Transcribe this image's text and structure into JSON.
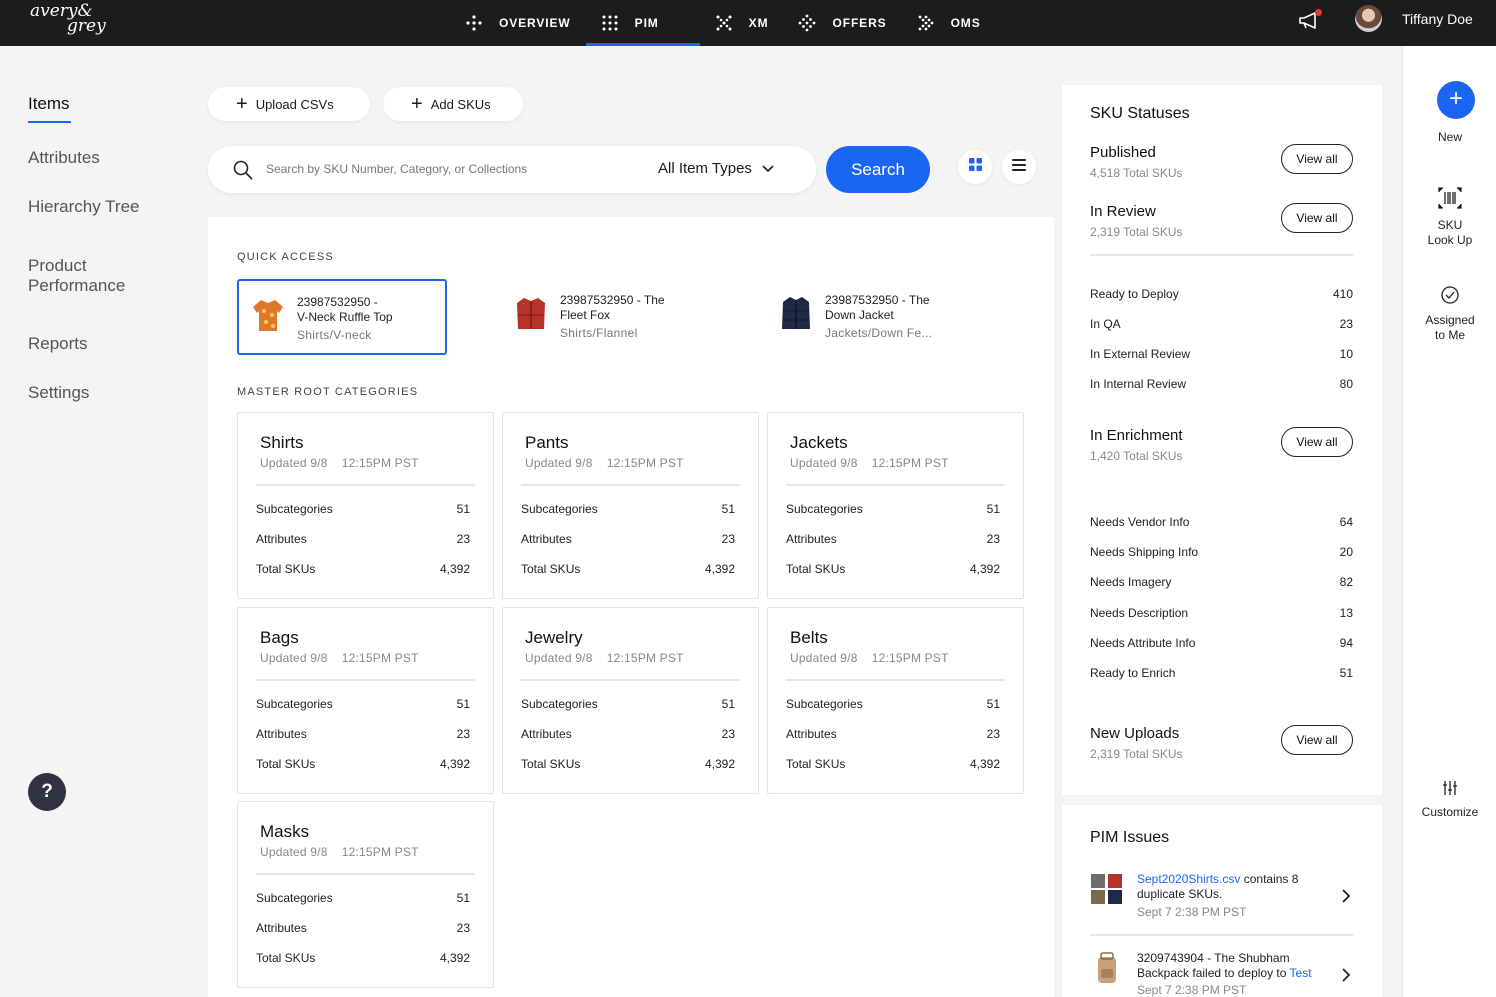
{
  "brand": {
    "line1": "avery&",
    "line2": "grey"
  },
  "topnav": [
    {
      "label": "OVERVIEW",
      "icon": "overview-icon",
      "active": false
    },
    {
      "label": "PIM",
      "icon": "pim-grid-icon",
      "active": true
    },
    {
      "label": "XM",
      "icon": "xm-icon",
      "active": false
    },
    {
      "label": "OFFERS",
      "icon": "offers-icon",
      "active": false
    },
    {
      "label": "OMS",
      "icon": "oms-icon",
      "active": false
    }
  ],
  "user": {
    "name": "Tiffany Doe"
  },
  "accent": "#1a66f2",
  "sidebar": {
    "items": [
      {
        "label": "Items"
      },
      {
        "label": "Attributes"
      },
      {
        "label": "Hierarchy Tree"
      },
      {
        "label": "Product Performance"
      },
      {
        "label": "Reports"
      },
      {
        "label": "Settings"
      }
    ],
    "help": "?"
  },
  "toolbar": {
    "upload_label": "Upload CSVs",
    "add_label": "Add SKUs"
  },
  "search": {
    "placeholder": "Search by SKU Number, Category, or Collections",
    "type_value": "All Item Types",
    "button": "Search"
  },
  "quick_access": {
    "label": "QUICK ACCESS",
    "items": [
      {
        "line1": "23987532950 -",
        "line2": "V-Neck Ruffle Top",
        "sub": "Shirts/V-neck"
      },
      {
        "line1": "23987532950 - The",
        "line2": "Fleet Fox",
        "sub": "Shirts/Flannel"
      },
      {
        "line1": "23987532950 - The",
        "line2": "Down Jacket",
        "sub": "Jackets/Down Fe..."
      }
    ]
  },
  "categories": {
    "label": "MASTER ROOT CATEGORIES",
    "row_labels": {
      "sub": "Subcategories",
      "attr": "Attributes",
      "skus": "Total SKUs"
    },
    "items": [
      {
        "name": "Shirts",
        "updated": "Updated 9/8    12:15PM PST",
        "sub": "51",
        "attr": "23",
        "skus": "4,392"
      },
      {
        "name": "Pants",
        "updated": "Updated 9/8    12:15PM PST",
        "sub": "51",
        "attr": "23",
        "skus": "4,392"
      },
      {
        "name": "Jackets",
        "updated": "Updated 9/8    12:15PM PST",
        "sub": "51",
        "attr": "23",
        "skus": "4,392"
      },
      {
        "name": "Bags",
        "updated": "Updated 9/8    12:15PM PST",
        "sub": "51",
        "attr": "23",
        "skus": "4,392"
      },
      {
        "name": "Jewelry",
        "updated": "Updated 9/8    12:15PM PST",
        "sub": "51",
        "attr": "23",
        "skus": "4,392"
      },
      {
        "name": "Belts",
        "updated": "Updated 9/8    12:15PM PST",
        "sub": "51",
        "attr": "23",
        "skus": "4,392"
      },
      {
        "name": "Masks",
        "updated": "Updated 9/8    12:15PM PST",
        "sub": "51",
        "attr": "23",
        "skus": "4,392"
      }
    ]
  },
  "sku_statuses": {
    "title": "SKU Statuses",
    "view_all": "View all",
    "published": {
      "title": "Published",
      "sub": "4,518 Total SKUs"
    },
    "in_review": {
      "title": "In Review",
      "sub": "2,319 Total SKUs"
    },
    "review_rows": [
      {
        "label": "Ready to Deploy",
        "value": "410"
      },
      {
        "label": "In QA",
        "value": "23"
      },
      {
        "label": "In External Review",
        "value": "10"
      },
      {
        "label": "In Internal Review",
        "value": "80"
      }
    ],
    "enrichment": {
      "title": "In Enrichment",
      "sub": "1,420 Total SKUs"
    },
    "enrich_rows": [
      {
        "label": "Needs Vendor Info",
        "value": "64"
      },
      {
        "label": "Needs Shipping Info",
        "value": "20"
      },
      {
        "label": "Needs Imagery",
        "value": "82"
      },
      {
        "label": "Needs Description",
        "value": "13"
      },
      {
        "label": "Needs Attribute Info",
        "value": "94"
      },
      {
        "label": "Ready to Enrich",
        "value": "51"
      }
    ],
    "new_uploads": {
      "title": "New Uploads",
      "sub": "2,319 Total SKUs"
    }
  },
  "pim_issues": {
    "title": "PIM Issues",
    "items": [
      {
        "link": "Sept2020Shirts.csv",
        "text": " contains 8 duplicate SKUs.",
        "date": "Sept 7 2:38 PM PST"
      },
      {
        "text": "3209743904 - The Shubham Backpack failed to deploy to ",
        "link": "Test",
        "date": "Sept 7 2:38 PM PST"
      }
    ]
  },
  "rail": {
    "new": "New",
    "sku_lookup_1": "SKU",
    "sku_lookup_2": "Look Up",
    "assigned_1": "Assigned",
    "assigned_2": "to Me",
    "customize": "Customize"
  }
}
